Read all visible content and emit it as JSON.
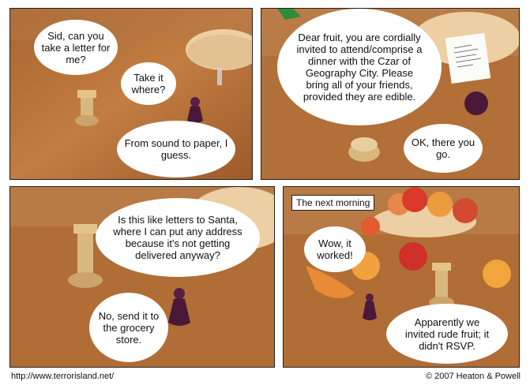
{
  "panels": [
    {
      "bubbles": [
        "Sid, can you take a letter for me?",
        "Take it where?",
        "From sound to paper, I guess."
      ]
    },
    {
      "bubbles": [
        "Dear fruit, you are cordially invited to attend/comprise a dinner with the Czar of Geography City. Please bring all of your friends, provided they are edible.",
        "OK, there you go."
      ]
    },
    {
      "bubbles": [
        "Is this like letters to Santa, where I can put any address because it's not getting delivered anyway?",
        "No, send it to the grocery store."
      ]
    },
    {
      "caption": "The next morning",
      "bubbles": [
        "Wow, it worked!",
        "Apparently we invited rude fruit; it didn't RSVP."
      ]
    }
  ],
  "footer": {
    "url": "http://www.terrorisland.net/",
    "copyright": "© 2007 Heaton & Powell"
  },
  "colors": {
    "table_wood": "#b5733a",
    "wall": "#d7b48d",
    "pawn": "#4a1838",
    "rook": "#d9b87d"
  }
}
